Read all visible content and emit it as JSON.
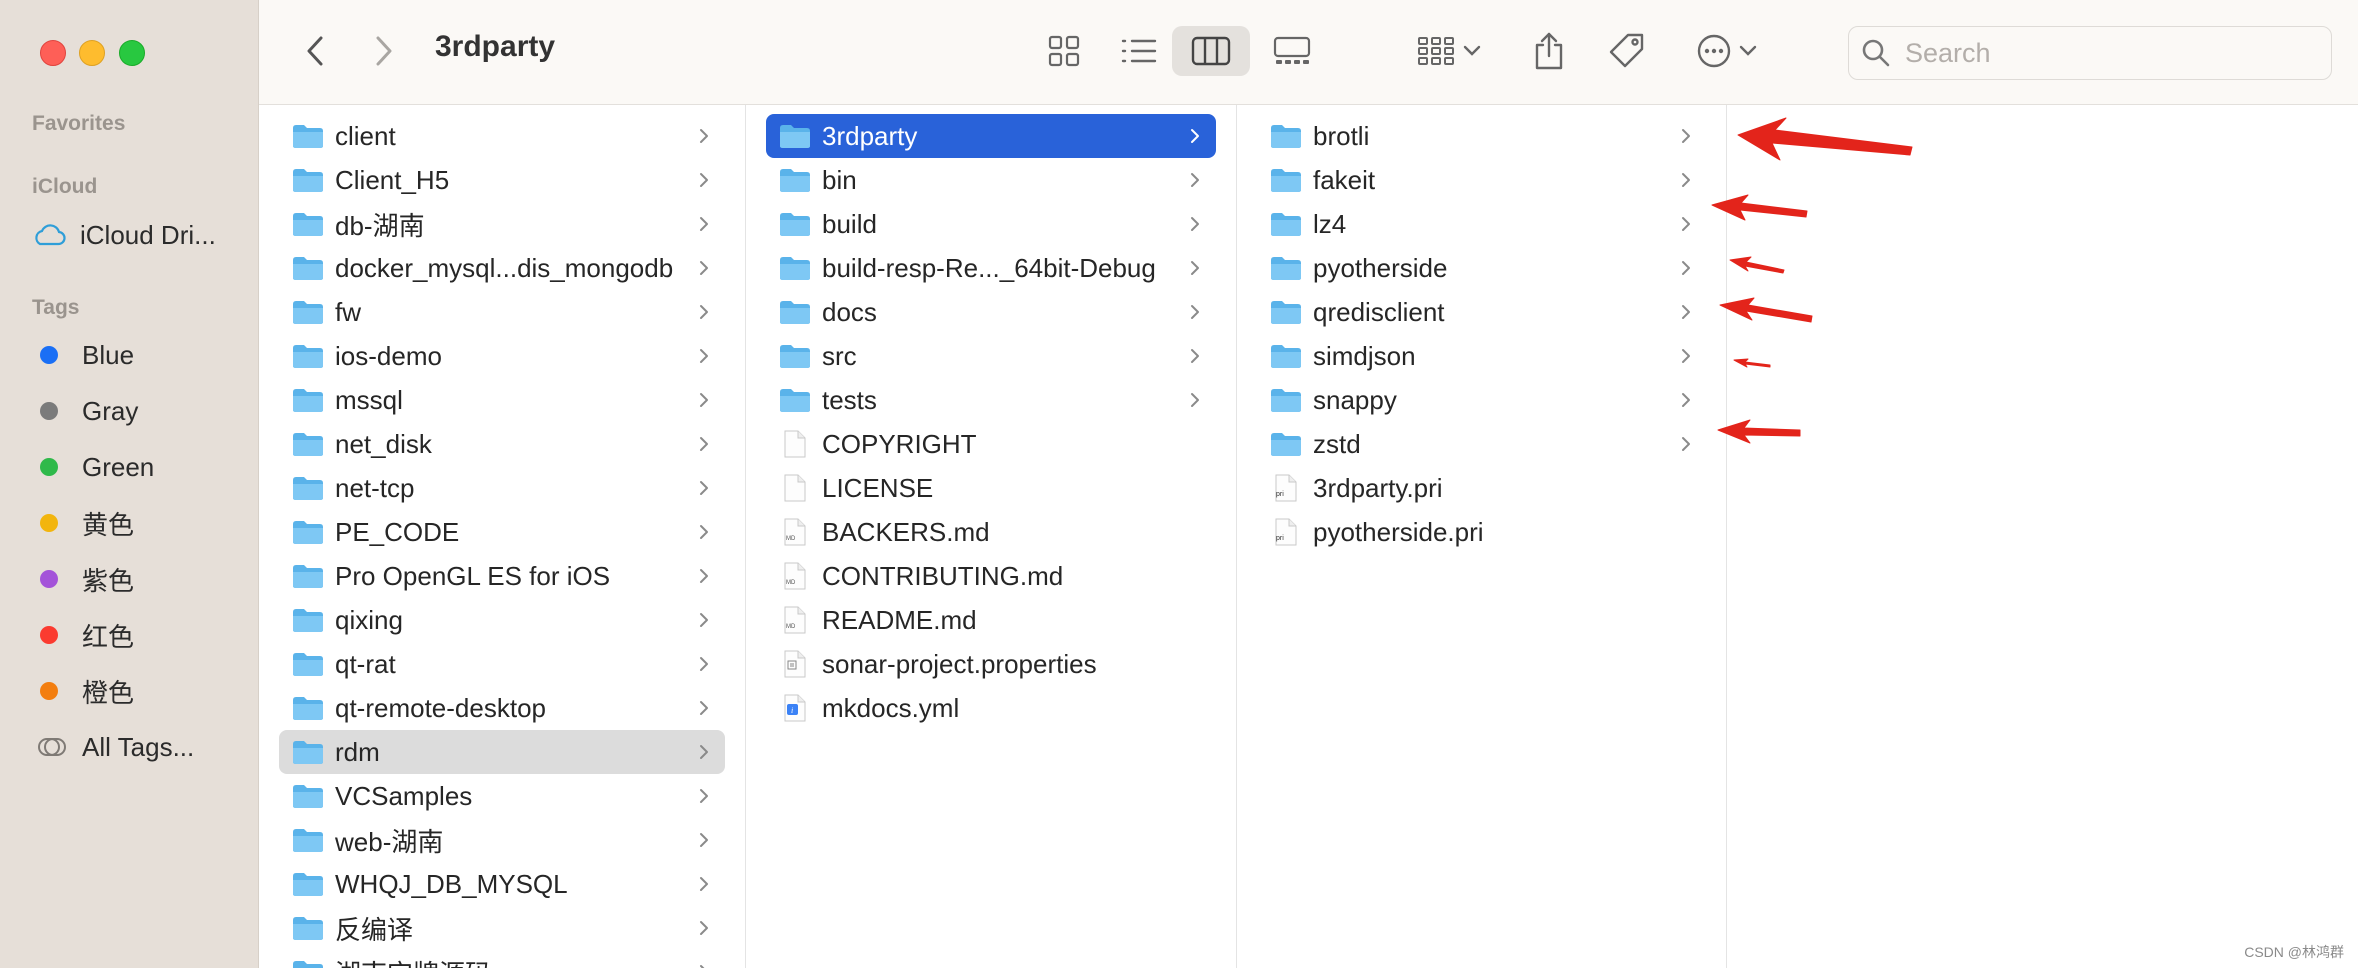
{
  "window": {
    "title": "3rdparty"
  },
  "sidebar": {
    "favorites_label": "Favorites",
    "icloud_label": "iCloud",
    "icloud_drive": "iCloud Dri...",
    "tags_label": "Tags",
    "tags": [
      {
        "label": "Blue",
        "color": "#1a6ff5"
      },
      {
        "label": "Gray",
        "color": "#7b7b7b"
      },
      {
        "label": "Green",
        "color": "#2fb94a"
      },
      {
        "label": "黄色",
        "color": "#f2b50e"
      },
      {
        "label": "紫色",
        "color": "#a453d9"
      },
      {
        "label": "红色",
        "color": "#fb3b30"
      },
      {
        "label": "橙色",
        "color": "#f37e0f"
      }
    ],
    "all_tags": "All Tags..."
  },
  "search": {
    "placeholder": "Search"
  },
  "columns": {
    "col1": [
      "client",
      "Client_H5",
      "db-湖南",
      "docker_mysql...dis_mongodb",
      "fw",
      "ios-demo",
      "mssql",
      "net_disk",
      "net-tcp",
      "PE_CODE",
      "Pro OpenGL ES for iOS",
      "qixing",
      "qt-rat",
      "qt-remote-desktop",
      "rdm",
      "VCSamples",
      "web-湖南",
      "WHQJ_DB_MYSQL",
      "反编译",
      "湖南宝牌源码"
    ],
    "col2": [
      {
        "label": "3rdparty",
        "type": "folder"
      },
      {
        "label": "bin",
        "type": "folder"
      },
      {
        "label": "build",
        "type": "folder"
      },
      {
        "label": "build-resp-Re..._64bit-Debug",
        "type": "folder"
      },
      {
        "label": "docs",
        "type": "folder"
      },
      {
        "label": "src",
        "type": "folder"
      },
      {
        "label": "tests",
        "type": "folder"
      },
      {
        "label": "COPYRIGHT",
        "type": "file"
      },
      {
        "label": "LICENSE",
        "type": "file"
      },
      {
        "label": "BACKERS.md",
        "type": "md"
      },
      {
        "label": "CONTRIBUTING.md",
        "type": "md"
      },
      {
        "label": "README.md",
        "type": "md"
      },
      {
        "label": "sonar-project.properties",
        "type": "props"
      },
      {
        "label": "mkdocs.yml",
        "type": "yml"
      }
    ],
    "col3": [
      {
        "label": "brotli",
        "type": "folder"
      },
      {
        "label": "fakeit",
        "type": "folder"
      },
      {
        "label": "lz4",
        "type": "folder"
      },
      {
        "label": "pyotherside",
        "type": "folder"
      },
      {
        "label": "qredisclient",
        "type": "folder"
      },
      {
        "label": "simdjson",
        "type": "folder"
      },
      {
        "label": "snappy",
        "type": "folder"
      },
      {
        "label": "zstd",
        "type": "folder"
      },
      {
        "label": "3rdparty.pri",
        "type": "pri"
      },
      {
        "label": "pyotherside.pri",
        "type": "pri"
      }
    ]
  },
  "icons": {
    "md_tag": "MD",
    "pri_tag": "pri",
    "yml_tag": "i"
  },
  "watermark": "CSDN @林鸿群",
  "colors": {
    "selection": "#2962d9",
    "folder": "#5ab3ea",
    "annotation": "#e3241b"
  }
}
